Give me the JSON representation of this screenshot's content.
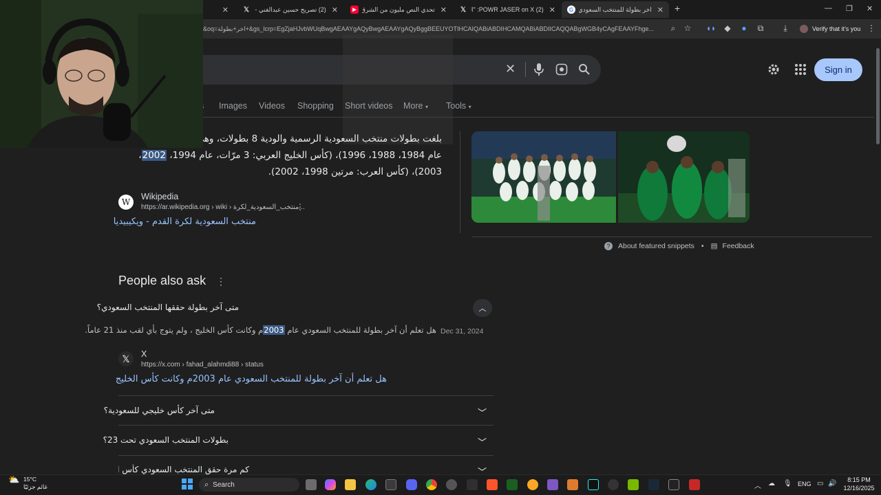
{
  "tabs": [
    {
      "title": "",
      "icon": "blank",
      "active": false
    },
    {
      "title": "(2) تصريح حسين عبدالغني - X / X",
      "icon": "x-logo-icon",
      "active": false
    },
    {
      "title": "تحدي النص مليون من الشرق للغرب",
      "icon": "youtube-icon",
      "active": false
    },
    {
      "title": "(2) POWR JASER on X: \"السيرفر",
      "icon": "x-logo-icon",
      "active": false
    },
    {
      "title": "اخر بطولة للمنتخب السعودي - Google",
      "icon": "google-icon",
      "active": true
    }
  ],
  "address": {
    "url": "&oq=اخر+بطولة+&gs_lcrp=EgZjaHJvbWUqBwgAEAAYgAQyBwgAEAAYgAQyBggBEEUYOTIHCAIQABiABDIHCAMQABiABDIICAQQABgWGB4yCAgFEAAYFhge...",
    "verify_label": "Verify that it's you"
  },
  "search": {
    "nav_items": [
      "s",
      "Images",
      "Videos",
      "Shopping",
      "Short videos",
      "More",
      "Tools"
    ],
    "signin_label": "Sign in"
  },
  "snippet": {
    "line1": "بلغت بطولات منتخب السعودية الرسمية والودية 8 بطولات، وهي",
    "line2_pre": "عام 1984، 1988، 1996)، (كأس الخليج العربي: 3 مرّات، عام 1994، ",
    "line2_hl": "2002",
    "line2_post": "،",
    "line3": "2003)، (كأس العرب: مرتين 1998، 2002).",
    "source_name": "Wikipedia",
    "source_url": "https://ar.wikipedia.org › wiki › منتخب_السعودية_لكرة...",
    "link": "منتخب السعودية لكرة القدم - ويكيبيديا",
    "about_label": "About featured snippets",
    "feedback_label": "Feedback"
  },
  "paa": {
    "title": "People also ask",
    "q1": "متى آخر بطولة حققها المنتخب السعودي؟",
    "answer_pre": "هل تعلم أن آخر بطولة للمنتخب السعودي عام ",
    "answer_hl": "2003",
    "answer_post": "م وكانت كأس الخليج ، ولم يتوج بأي لقب منذ 21 عاماً.",
    "answer_date": "Dec 31, 2024",
    "source_name": "X",
    "source_url": "https://x.com › fahad_alahmdi88 › status",
    "link": "هل تعلم أن آخر بطولة للمنتخب السعودي عام 2003م وكانت كأس الخليج",
    "q2": "متى آخر كأس خليجي للسعودية؟",
    "q3": "بطولات المنتخب السعودي تحت 23؟",
    "q4": "كم مرة حقق المنتخب السعودي كأس العرب؟"
  },
  "taskbar": {
    "search_label": "Search",
    "weather_temp": "15°C",
    "weather_text": "غائم جزئيًا",
    "lang": "ENG",
    "time": "8:15 PM",
    "date": "12/16/2025"
  },
  "colors": {
    "accent_blue": "#a8c7fa",
    "link": "#99c3ff",
    "highlight": "#3c5a86"
  }
}
